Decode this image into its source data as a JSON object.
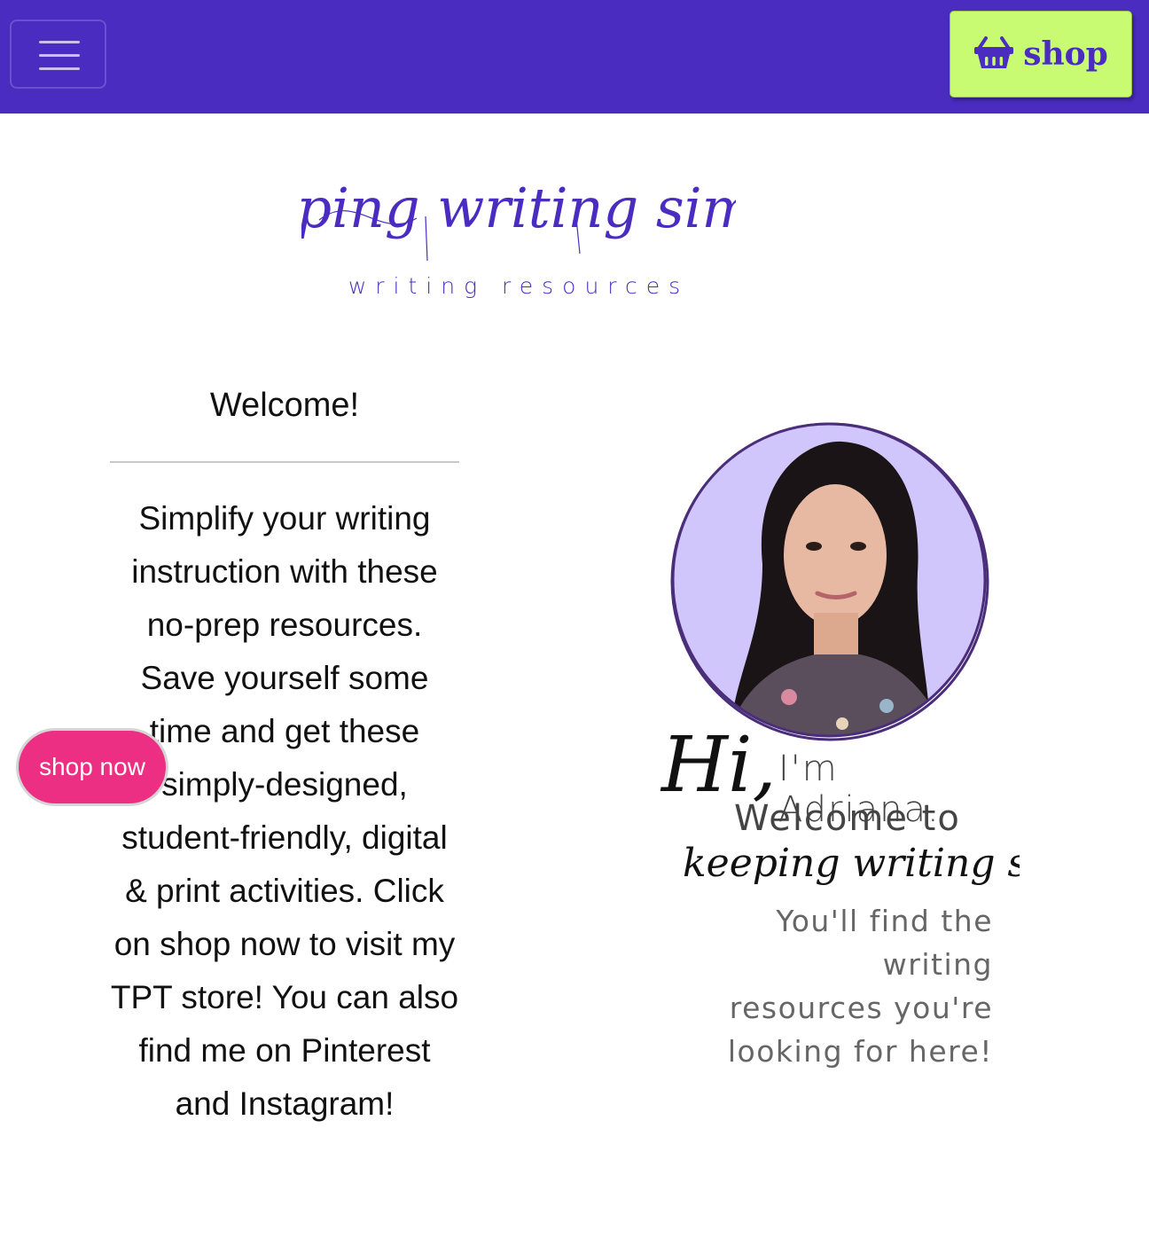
{
  "colors": {
    "brand_purple": "#4a2cc1",
    "shop_button_green": "#c8fb72",
    "shop_now_pink": "#ec2f83",
    "avatar_bg_lavender": "#d0c6fb"
  },
  "navbar": {
    "menu_icon": "hamburger-menu-icon",
    "shop_icon": "shopping-basket-icon",
    "shop_label": "shop"
  },
  "logo": {
    "script_text": "keeping writing simple",
    "subtitle": "writing resources"
  },
  "intro": {
    "title": "Welcome!",
    "body": "Simplify your writing instruction with these no-prep resources. Save yourself some time and get these simply-designed, student-friendly, digital & print activities. Click on shop now to visit my TPT store! You can also find me on Pinterest and Instagram!"
  },
  "floating_button": {
    "label": "shop now"
  },
  "greeting": {
    "hi": "Hi,",
    "name_line": "I'm Adriana.",
    "welcome_line": "Welcome to",
    "brand_script": "keeping writing simple.",
    "tagline_lines": [
      "You'll find the writing",
      "resources you're",
      "looking for here!"
    ]
  }
}
